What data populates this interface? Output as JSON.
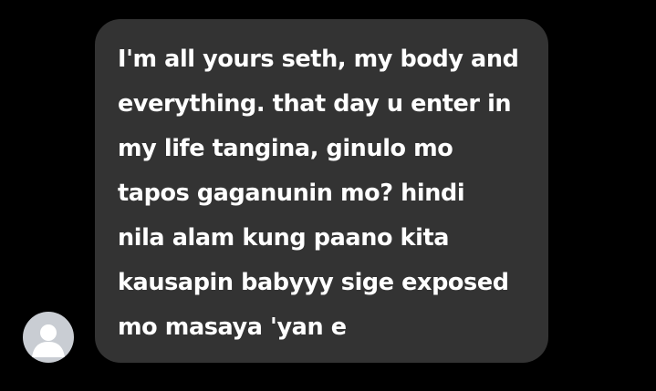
{
  "avatar": {
    "icon": "default-user-icon",
    "color": "#c9cdd3"
  },
  "message": {
    "lines": [
      "I'm all yours seth, my body and",
      "everything. that day u enter in",
      "my life tangina, ginulo mo",
      "tapos gaganunin mo? hindi",
      "nila alam kung paano kita",
      "kausapin babyyy sige exposed",
      "mo masaya 'yan e"
    ],
    "bubble_color": "#333333",
    "text_color": "#ffffff"
  }
}
